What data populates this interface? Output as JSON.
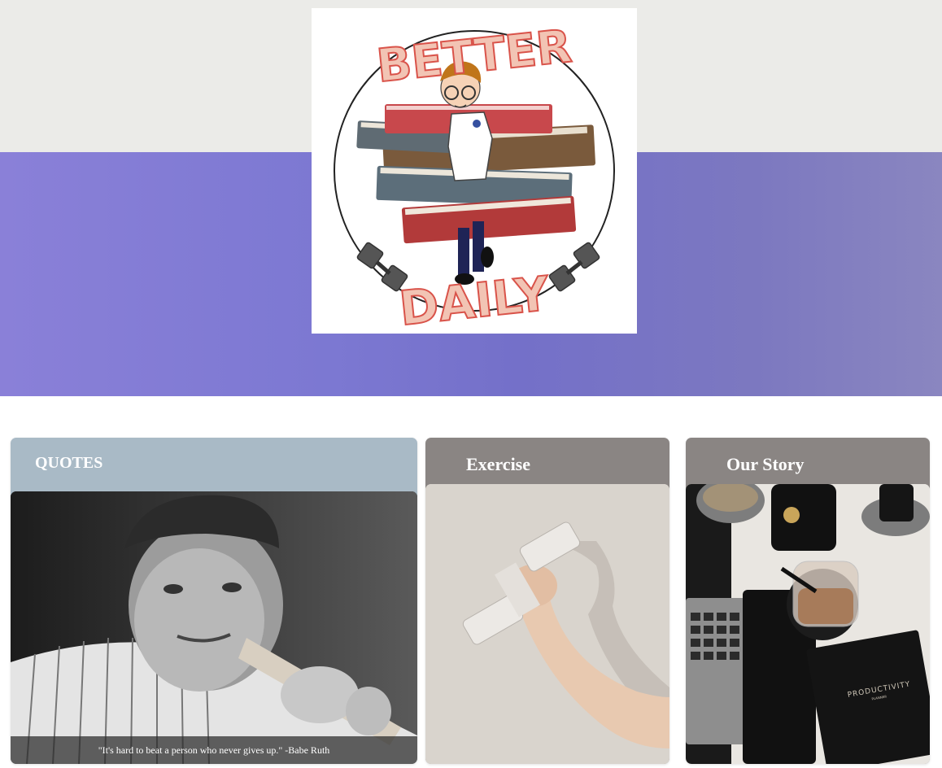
{
  "logo": {
    "text_top": "BETTER",
    "text_bottom": "DAILY"
  },
  "cards": {
    "quotes": {
      "title": "QUOTES",
      "quote": "\"It's hard to beat a person who never gives up.\" -Babe Ruth"
    },
    "exercise": {
      "title": "Exercise"
    },
    "story": {
      "title": "Our Story",
      "planner_text": "PRODUCTIVITY",
      "planner_subtext": "PLANNER"
    }
  },
  "colors": {
    "hero_top": "#ebebe8",
    "hero_band": "#7c78d2",
    "quotes_header": "#a9bac6",
    "card_header": "#8a8583",
    "logo_letters": "#f2c4b4",
    "logo_letters_shadow": "#d9534a"
  }
}
